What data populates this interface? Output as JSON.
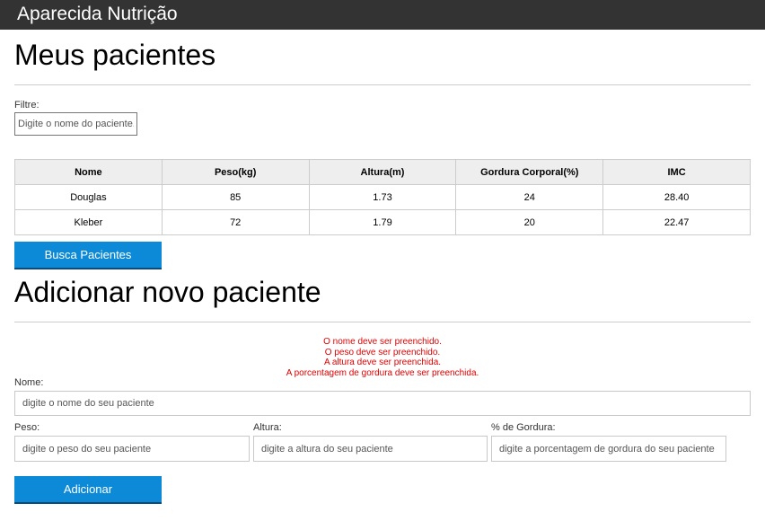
{
  "header": {
    "brand": "Aparecida Nutrição"
  },
  "patients_section": {
    "title": "Meus pacientes",
    "filter_label": "Filtre:",
    "filter_placeholder": "Digite o nome do paciente.",
    "table": {
      "columns": [
        "Nome",
        "Peso(kg)",
        "Altura(m)",
        "Gordura Corporal(%)",
        "IMC"
      ],
      "rows": [
        [
          "Douglas",
          "85",
          "1.73",
          "24",
          "28.40"
        ],
        [
          "Kleber",
          "72",
          "1.79",
          "20",
          "22.47"
        ]
      ]
    },
    "search_button": "Busca Pacientes"
  },
  "add_section": {
    "title": "Adicionar novo paciente",
    "errors": [
      "O nome deve ser preenchido.",
      "O peso deve ser preenchido.",
      "A altura deve ser preenchida.",
      "A porcentagem de gordura deve ser preenchida."
    ],
    "name_label": "Nome:",
    "name_placeholder": "digite o nome do seu paciente",
    "weight_label": "Peso:",
    "weight_placeholder": "digite o peso do seu paciente",
    "height_label": "Altura:",
    "height_placeholder": "digite a altura do seu paciente",
    "fat_label": "% de Gordura:",
    "fat_placeholder": "digite a porcentagem de gordura do seu paciente",
    "add_button": "Adicionar"
  },
  "colors": {
    "header_bg": "#333333",
    "button_bg": "#0d8ad7",
    "error_text": "#e00000",
    "table_header_bg": "#eeeeee"
  }
}
